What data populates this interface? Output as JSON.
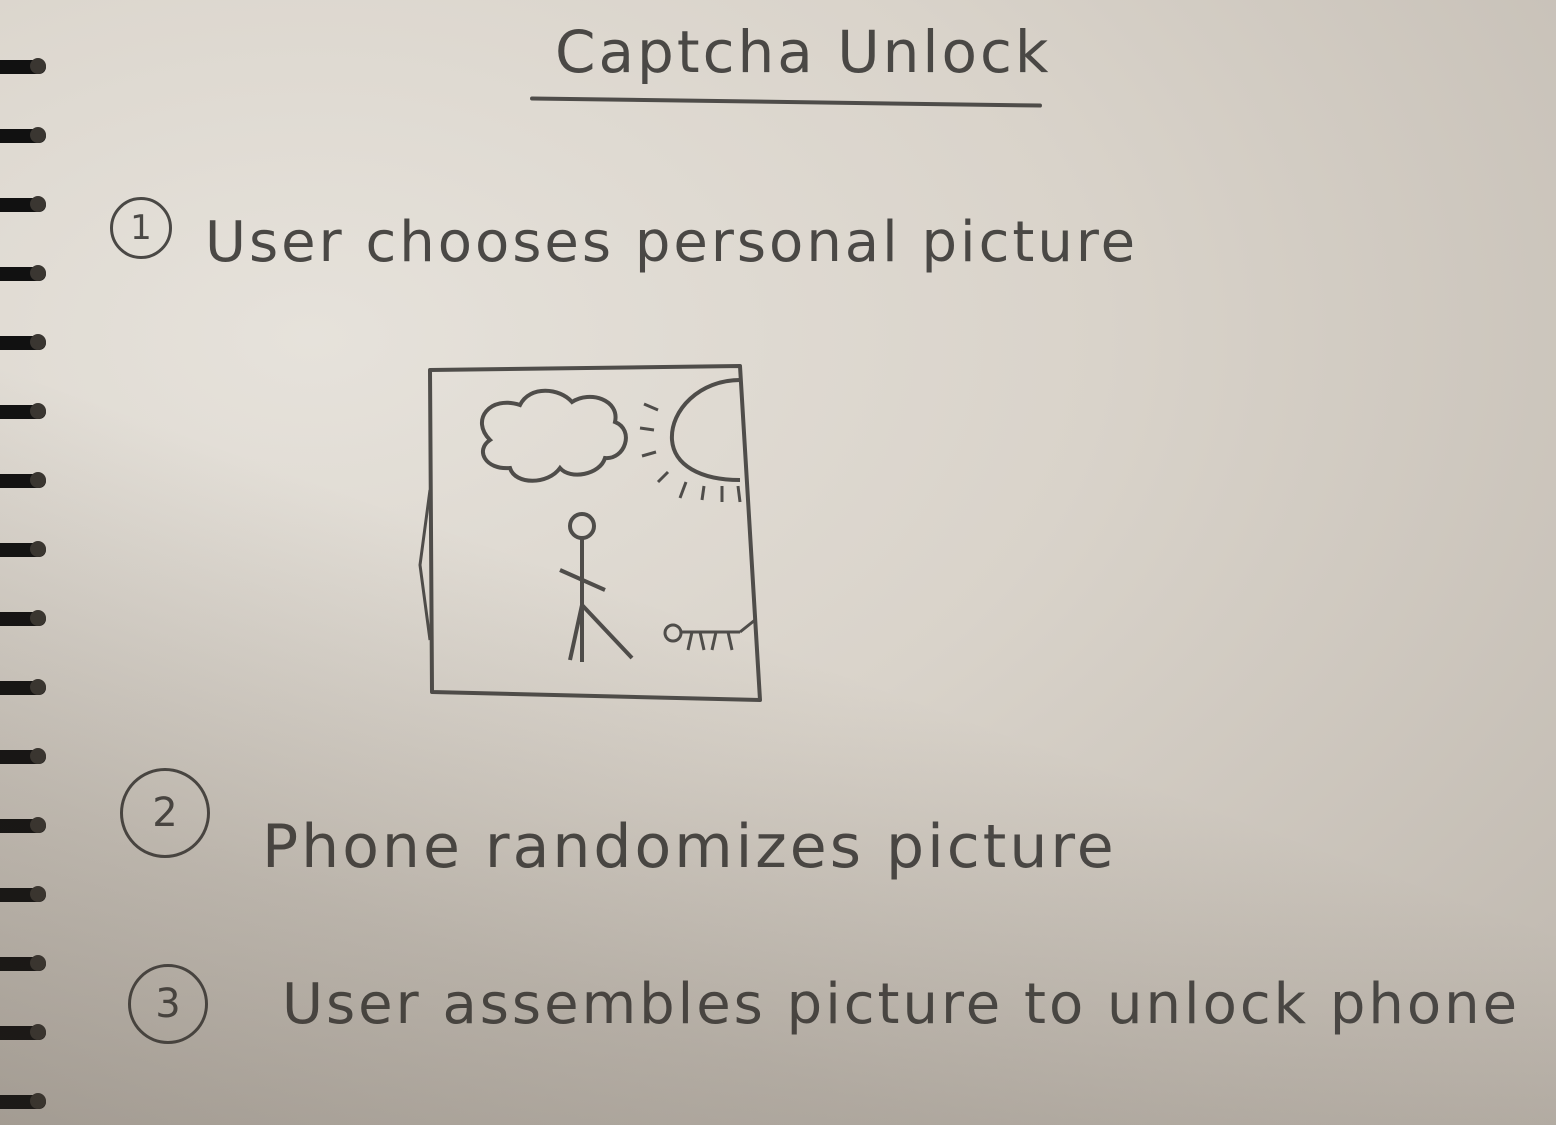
{
  "title": "Captcha Unlock",
  "steps": [
    {
      "number": "1",
      "text": "User chooses personal picture"
    },
    {
      "number": "2",
      "text": "Phone randomizes picture"
    },
    {
      "number": "3",
      "text": "User assembles picture to unlock phone"
    }
  ],
  "sketch": {
    "elements": [
      "cloud",
      "sun",
      "stick-figure",
      "dog"
    ]
  },
  "colors": {
    "paper": "#dcd7cf",
    "pencil": "#4a4845",
    "spiral": "#111111"
  }
}
